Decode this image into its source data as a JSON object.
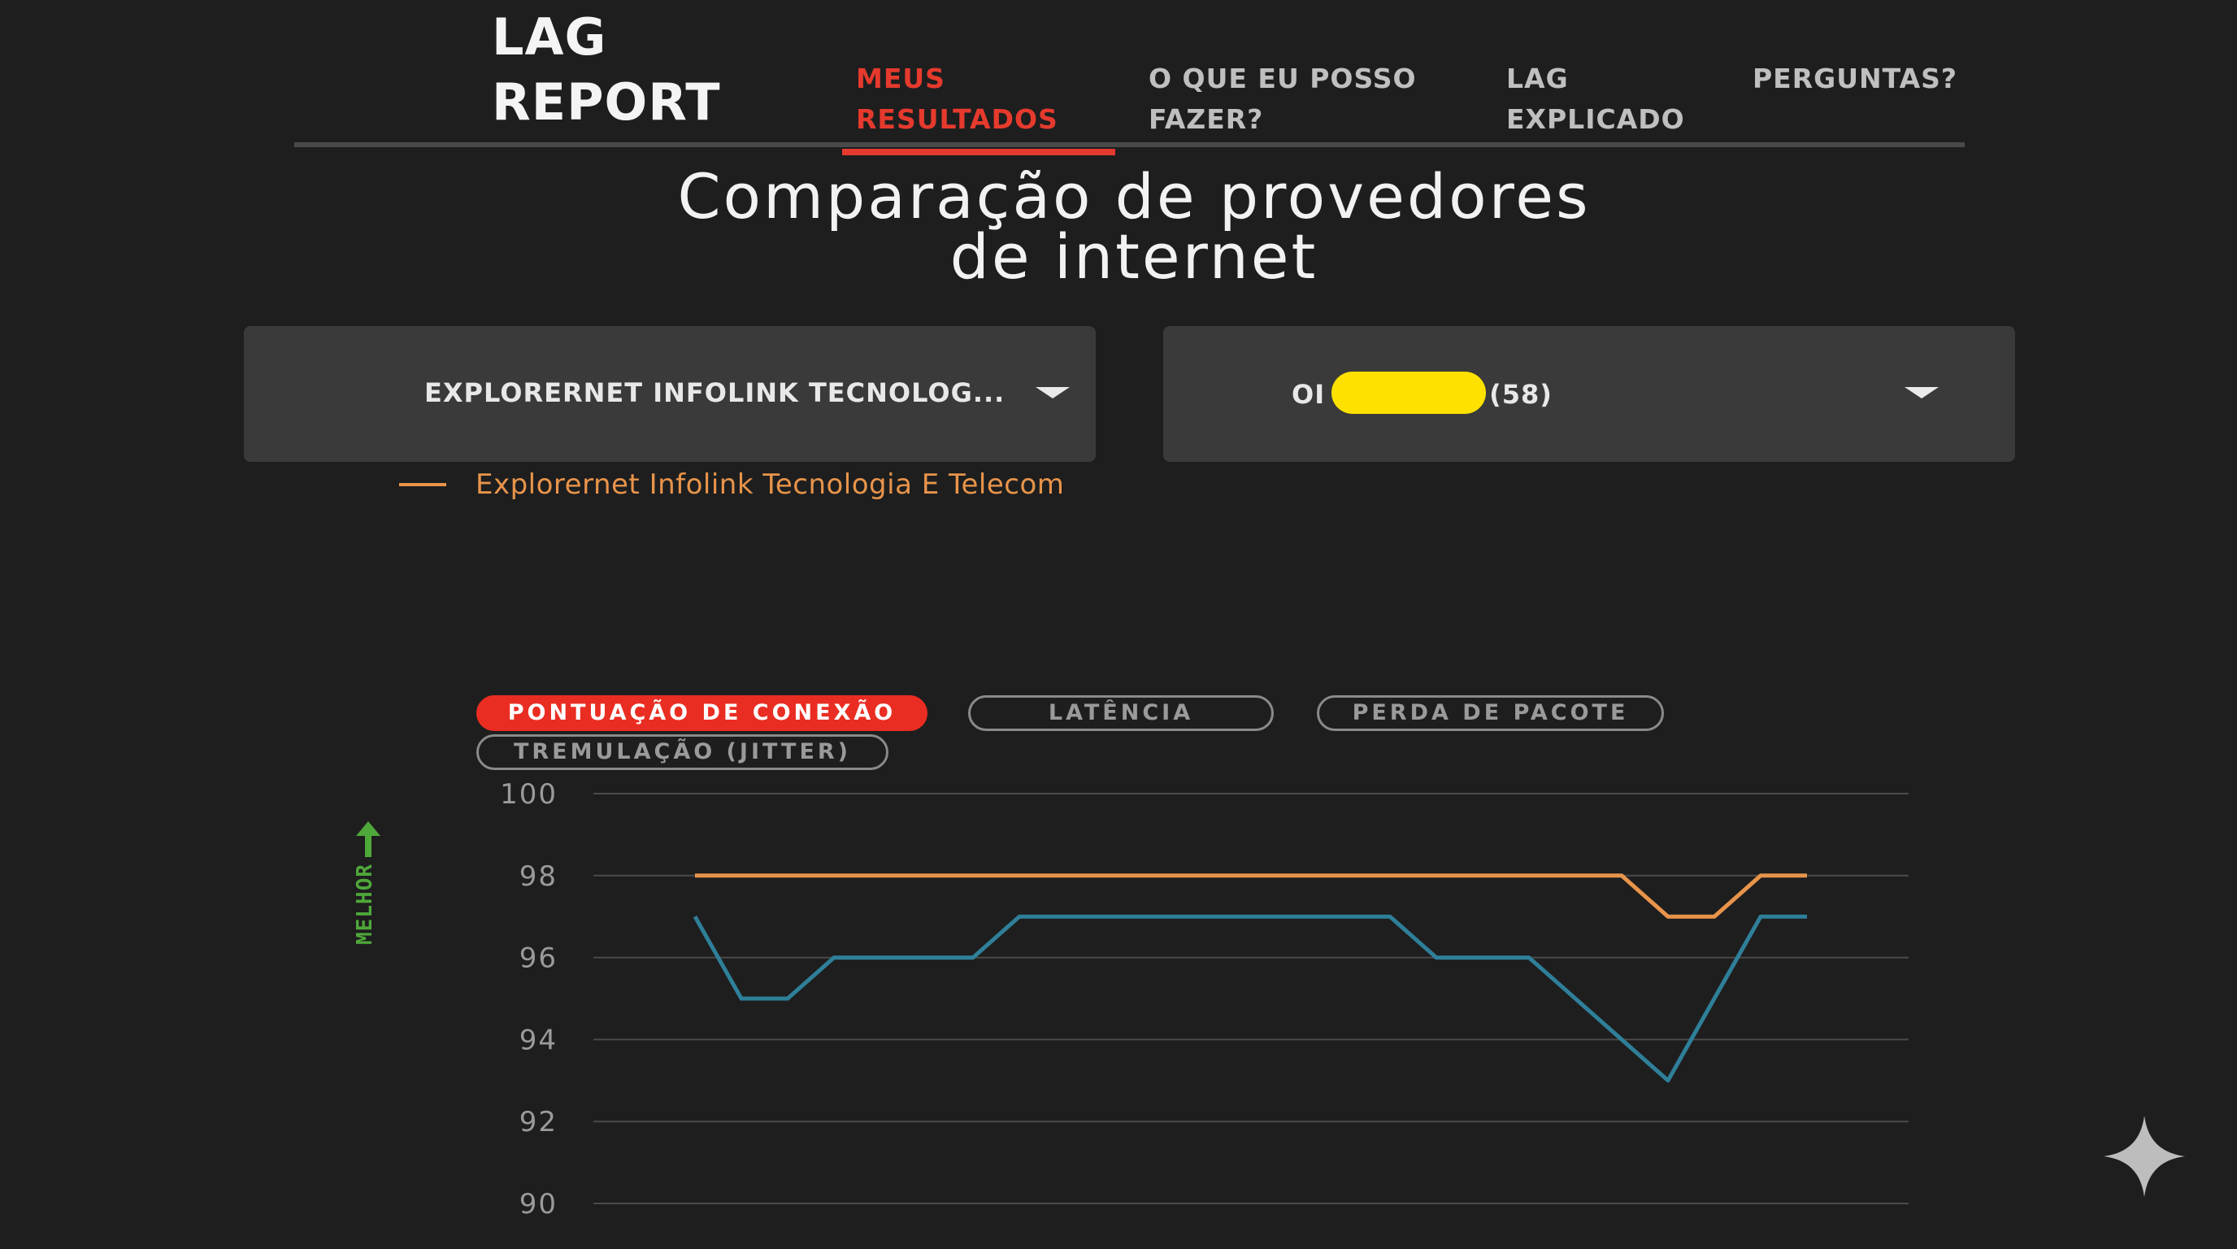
{
  "header": {
    "logo": {
      "line1": "LAG",
      "line2": "REPORT"
    },
    "nav": [
      {
        "line1": "MEUS",
        "line2": "RESULTADOS",
        "active": true
      },
      {
        "line1": "O QUE EU POSSO",
        "line2": "FAZER?",
        "active": false
      },
      {
        "line1": "LAG",
        "line2": "EXPLICADO",
        "active": false
      },
      {
        "line1": "PERGUNTAS?",
        "line2": "",
        "active": false
      }
    ]
  },
  "title": {
    "line1": "Comparação de provedores",
    "line2": "de internet"
  },
  "selectors": {
    "left": {
      "value": "EXPLORERNET INFOLINK TECNOLOG..."
    },
    "right": {
      "prefix": "OI",
      "suffix": "(58)"
    }
  },
  "legend": {
    "label": "Explorernet Infolink Tecnologia E Telecom"
  },
  "metric_tabs": [
    {
      "label": "PONTUAÇÃO DE CONEXÃO",
      "active": true
    },
    {
      "label": "LATÊNCIA",
      "active": false
    },
    {
      "label": "PERDA DE PACOTE",
      "active": false
    },
    {
      "label": "TREMULAÇÃO (JITTER)",
      "active": false
    }
  ],
  "better_label": "MELHOR",
  "colors": {
    "accent": "#e53a2d",
    "series_orange": "#e8944a",
    "series_blue": "#2f7f99",
    "better_green": "#4fa83a",
    "redaction": "#ffe100"
  },
  "chart_data": {
    "type": "line",
    "y_ticks": [
      100,
      98,
      96,
      94,
      92,
      90
    ],
    "ylim": [
      90,
      100
    ],
    "grid": true,
    "x": [
      0,
      1,
      2,
      3,
      4,
      5,
      6,
      7,
      8,
      9,
      10,
      11,
      12,
      13,
      14,
      15,
      16,
      17,
      18,
      19,
      20,
      21,
      22,
      23,
      24
    ],
    "series": [
      {
        "name": "Explorernet Infolink Tecnologia E Telecom",
        "color": "#e8944a",
        "values": [
          98,
          98,
          98,
          98,
          98,
          98,
          98,
          98,
          98,
          98,
          98,
          98,
          98,
          98,
          98,
          98,
          98,
          98,
          98,
          98,
          98,
          97,
          97,
          98,
          98
        ]
      },
      {
        "color": "#2f7f99",
        "values": [
          97,
          95,
          95,
          96,
          96,
          96,
          96,
          97,
          97,
          97,
          97,
          97,
          97,
          97,
          97,
          97,
          96,
          96,
          96,
          95,
          94,
          93,
          95,
          97,
          97
        ]
      }
    ]
  }
}
